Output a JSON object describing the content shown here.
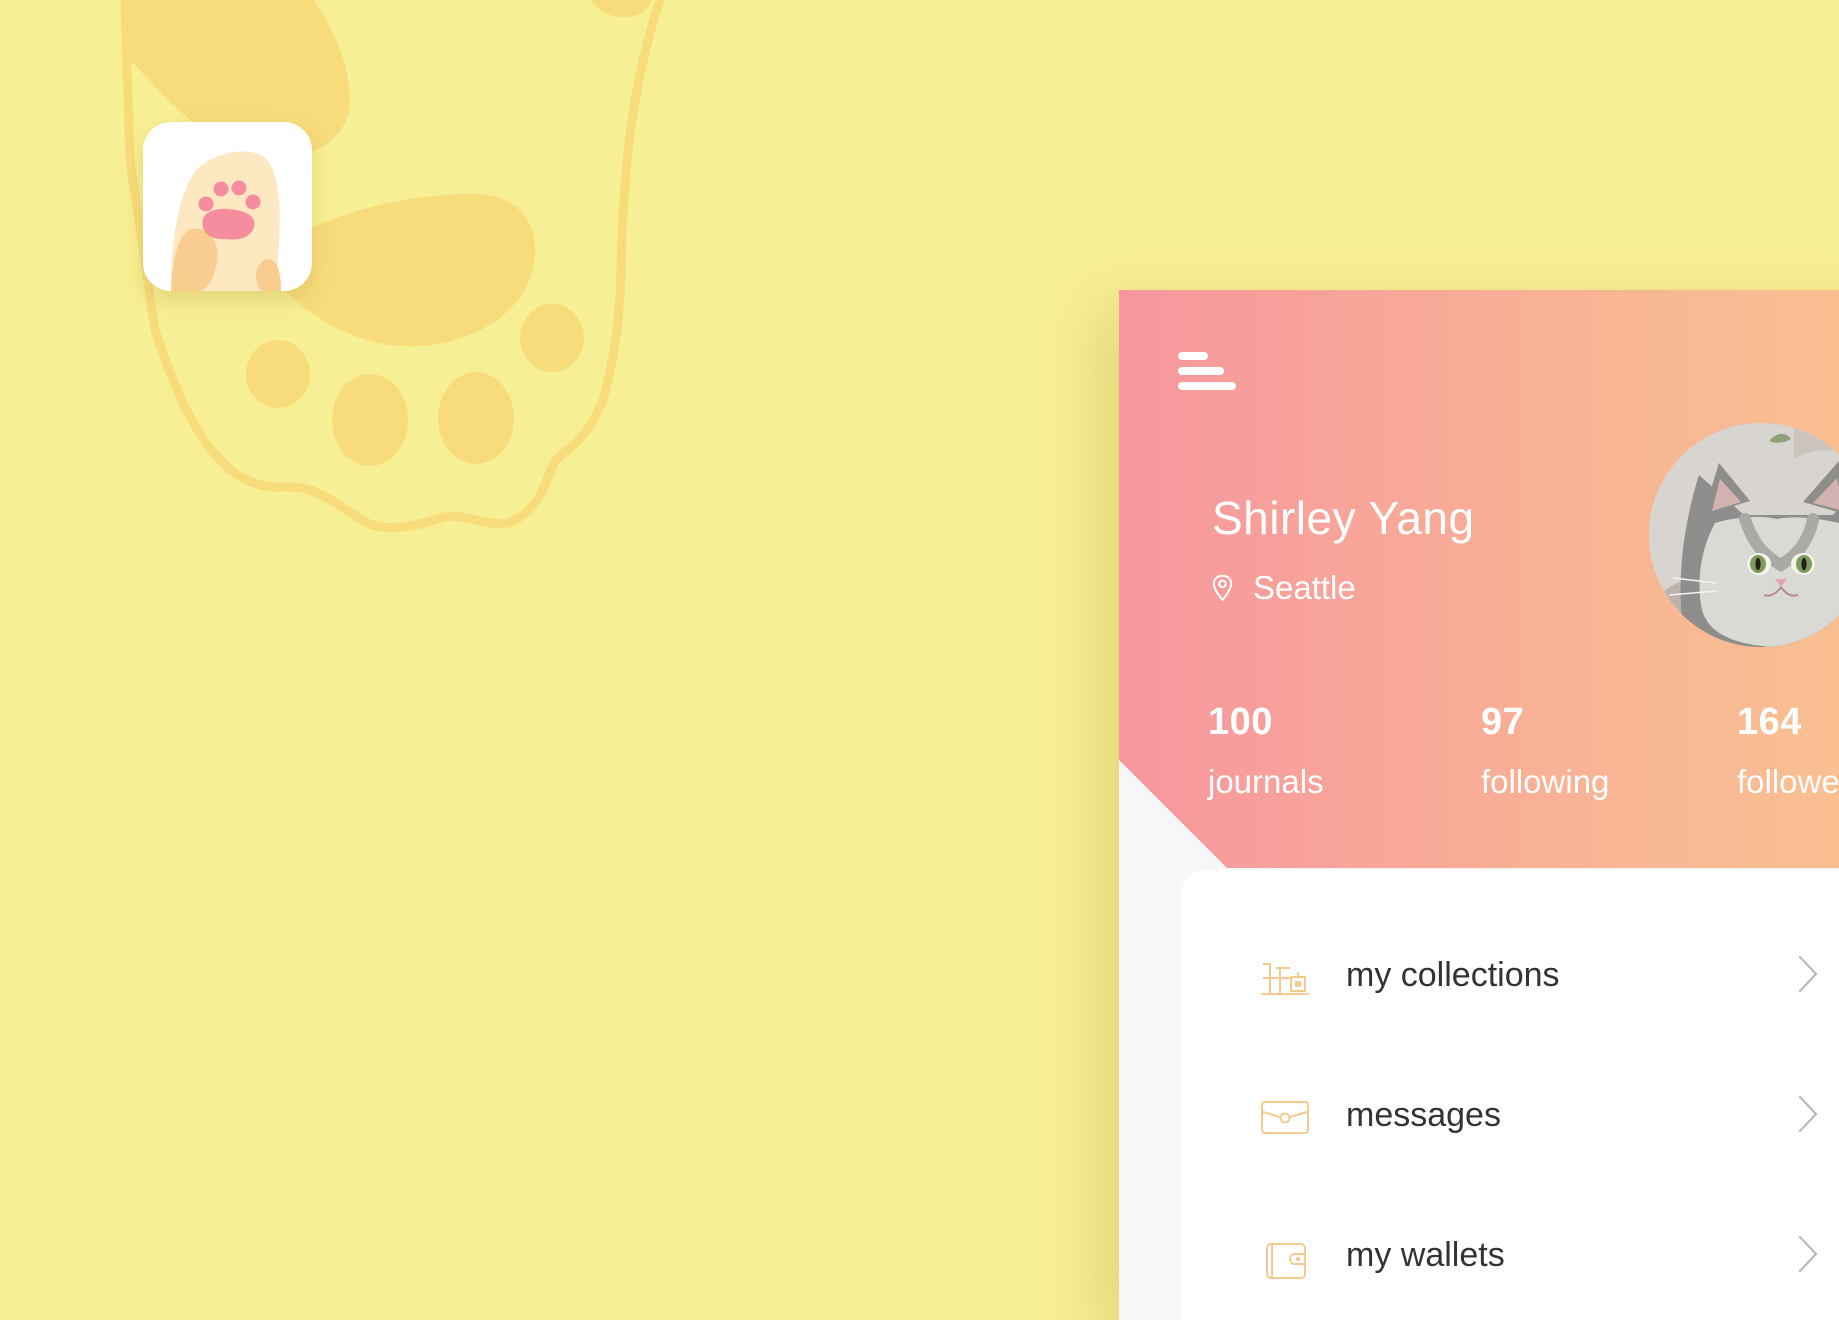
{
  "colors": {
    "background": "#f7ef93",
    "paw_accent": "#f8dc7b",
    "header_start": "#f7969e",
    "header_end": "#f9c190",
    "menu_icon": "#f6c98f",
    "text_dark": "#333333"
  },
  "app_icon": {
    "icon": "cat-paw-icon"
  },
  "profile": {
    "menu_icon": "hamburger-menu-icon",
    "name": "Shirley Yang",
    "location_icon": "location-pin-icon",
    "location": "Seattle",
    "avatar_icon": "cat-avatar"
  },
  "stats": [
    {
      "value": "100",
      "label": "journals"
    },
    {
      "value": "97",
      "label": "following"
    },
    {
      "value": "164",
      "label": "followers"
    }
  ],
  "menu": {
    "items": [
      {
        "label": "my collections",
        "icon": "collections-icon"
      },
      {
        "label": "messages",
        "icon": "message-icon"
      },
      {
        "label": "my wallets",
        "icon": "wallet-icon"
      }
    ],
    "chevron_icon": "chevron-right-icon"
  }
}
